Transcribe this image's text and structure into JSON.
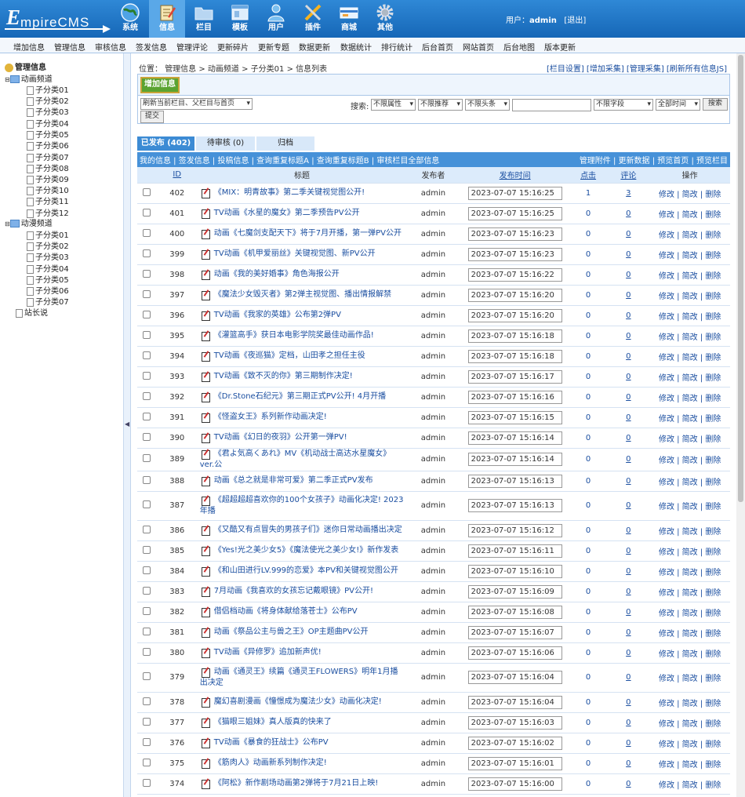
{
  "header": {
    "logo_main": "E",
    "logo_rest": "mpireCMS",
    "user_label": "用户：",
    "user_name": "admin",
    "logout": "[退出]",
    "menus": [
      {
        "label": "系统",
        "icon": "globe-icon"
      },
      {
        "label": "信息",
        "icon": "notepad-icon"
      },
      {
        "label": "栏目",
        "icon": "folder-icon"
      },
      {
        "label": "模板",
        "icon": "template-window-icon"
      },
      {
        "label": "用户",
        "icon": "user-icon"
      },
      {
        "label": "插件",
        "icon": "plugin-tools-icon"
      },
      {
        "label": "商城",
        "icon": "shop-card-icon"
      },
      {
        "label": "其他",
        "icon": "gear-icon"
      }
    ]
  },
  "subnav": [
    "增加信息",
    "管理信息",
    "审核信息",
    "签发信息",
    "管理评论",
    "更新碎片",
    "更新专题",
    "数据更新",
    "数据统计",
    "排行统计",
    "后台首页",
    "网站首页",
    "后台地图",
    "版本更新"
  ],
  "tree": {
    "root": "管理信息",
    "groups": [
      {
        "name": "动画频道",
        "items": [
          "子分类01",
          "子分类02",
          "子分类03",
          "子分类04",
          "子分类05",
          "子分类06",
          "子分类07",
          "子分类08",
          "子分类09",
          "子分类10",
          "子分类11",
          "子分类12"
        ]
      },
      {
        "name": "动漫频道",
        "items": [
          "子分类01",
          "子分类02",
          "子分类03",
          "子分类04",
          "子分类05",
          "子分类06",
          "子分类07"
        ]
      }
    ],
    "last": "站长说"
  },
  "breadcrumb": {
    "prefix": "位置：",
    "path": "管理信息 > 动画频道 > 子分类01 > 信息列表",
    "right": "[栏目设置] [增加采集] [管理采集] [刷新所有信息JS]"
  },
  "toolbar": {
    "add": "增加信息",
    "refresh_select": "刷新当前栏目、父栏目与首页",
    "submit": "提交",
    "search_label": "搜索:",
    "f1": "不限属性",
    "f2": "不限推荐",
    "f3": "不限头条",
    "f4": "不限字段",
    "f5": "全部时间",
    "search_btn": "搜索"
  },
  "tabs": [
    "已发布 (402)",
    "待审核 (0)",
    "归档"
  ],
  "bar": {
    "left": "我的信息 | 签发信息 | 投稿信息 | 查询重复标题A | 查询重复标题B | 审核栏目全部信息",
    "right": "管理附件 | 更新数据 | 预览首页 | 预览栏目"
  },
  "cols": {
    "id": "ID",
    "title": "标题",
    "author": "发布者",
    "time": "发布时间",
    "clicks": "点击",
    "comments": "评论",
    "ops": "操作"
  },
  "ops": "修改 | 简改 | 删除",
  "rows": [
    [
      "402",
      "《MIX：明青故事》第二季关键视觉图公开!",
      "admin",
      "2023-07-07 15:16:25",
      "1",
      "3"
    ],
    [
      "401",
      "TV动画《水星的魔女》第二季预告PV公开",
      "admin",
      "2023-07-07 15:16:25",
      "0",
      "0"
    ],
    [
      "400",
      "动画《七魔剑支配天下》将于7月开播，第一弹PV公开",
      "admin",
      "2023-07-07 15:16:23",
      "0",
      "0"
    ],
    [
      "399",
      "TV动画《机甲爱丽丝》关键视觉图、新PV公开",
      "admin",
      "2023-07-07 15:16:23",
      "0",
      "0"
    ],
    [
      "398",
      "动画《我的美好婚事》角色海报公开",
      "admin",
      "2023-07-07 15:16:22",
      "0",
      "0"
    ],
    [
      "397",
      "《魔法少女毁灭者》第2弹主视觉图、播出情报解禁",
      "admin",
      "2023-07-07 15:16:20",
      "0",
      "0"
    ],
    [
      "396",
      "TV动画《我家的英雄》公布第2弹PV",
      "admin",
      "2023-07-07 15:16:20",
      "0",
      "0"
    ],
    [
      "395",
      "《灌篮高手》获日本电影学院奖最佳动画作品!",
      "admin",
      "2023-07-07 15:16:18",
      "0",
      "0"
    ],
    [
      "394",
      "TV动画《夜巡猫》定档，山田孝之担任主役",
      "admin",
      "2023-07-07 15:16:18",
      "0",
      "0"
    ],
    [
      "393",
      "TV动画《致不灭的你》第三期制作决定!",
      "admin",
      "2023-07-07 15:16:17",
      "0",
      "0"
    ],
    [
      "392",
      "《Dr.Stone石纪元》第三期正式PV公开! 4月开播",
      "admin",
      "2023-07-07 15:16:16",
      "0",
      "0"
    ],
    [
      "391",
      "《怪盗女王》系列新作动画决定!",
      "admin",
      "2023-07-07 15:16:15",
      "0",
      "0"
    ],
    [
      "390",
      "TV动画《幻日的夜羽》公开第一弹PV!",
      "admin",
      "2023-07-07 15:16:14",
      "0",
      "0"
    ],
    [
      "389",
      "《君よ気高くあれ》MV《机动战士高达水星魔女》ver.公",
      "admin",
      "2023-07-07 15:16:14",
      "0",
      "0"
    ],
    [
      "388",
      "动画《总之就是非常可爱》第二季正式PV发布",
      "admin",
      "2023-07-07 15:16:13",
      "0",
      "0"
    ],
    [
      "387",
      "《超超超超喜欢你的100个女孩子》动画化决定! 2023年播",
      "admin",
      "2023-07-07 15:16:13",
      "0",
      "0"
    ],
    [
      "386",
      "《又酷又有点冒失的男孩子们》迷你日常动画播出决定",
      "admin",
      "2023-07-07 15:16:12",
      "0",
      "0"
    ],
    [
      "385",
      "《Yes!光之美少女5》《魔法使光之美少女!》新作发表",
      "admin",
      "2023-07-07 15:16:11",
      "0",
      "0"
    ],
    [
      "384",
      "《和山田进行LV.999的恋爱》本PV和关键视觉图公开",
      "admin",
      "2023-07-07 15:16:10",
      "0",
      "0"
    ],
    [
      "383",
      "7月动画《我喜欢的女孩忘记戴眼镜》PV公开!",
      "admin",
      "2023-07-07 15:16:09",
      "0",
      "0"
    ],
    [
      "382",
      "借侣档动画《将身体献给落苍士》公布PV",
      "admin",
      "2023-07-07 15:16:08",
      "0",
      "0"
    ],
    [
      "381",
      "动画《祭品公主与兽之王》OP主题曲PV公开",
      "admin",
      "2023-07-07 15:16:07",
      "0",
      "0"
    ],
    [
      "380",
      "TV动画《异修罗》追加新声优!",
      "admin",
      "2023-07-07 15:16:06",
      "0",
      "0"
    ],
    [
      "379",
      "动画《通灵王》续篇《通灵王FLOWERS》明年1月播出决定",
      "admin",
      "2023-07-07 15:16:04",
      "0",
      "0"
    ],
    [
      "378",
      "魔幻喜剧漫画《憧憬成为魔法少女》动画化决定!",
      "admin",
      "2023-07-07 15:16:04",
      "0",
      "0"
    ],
    [
      "377",
      "《猫眼三姐妹》真人版真的快来了",
      "admin",
      "2023-07-07 15:16:03",
      "0",
      "0"
    ],
    [
      "376",
      "TV动画《暴食的狂战士》公布PV",
      "admin",
      "2023-07-07 15:16:02",
      "0",
      "0"
    ],
    [
      "375",
      "《筋肉人》动画新系列制作决定!",
      "admin",
      "2023-07-07 15:16:01",
      "0",
      "0"
    ],
    [
      "374",
      "《阿松》新作剧场动画第2弹将于7月21日上映!",
      "admin",
      "2023-07-07 15:16:00",
      "0",
      "0"
    ]
  ]
}
